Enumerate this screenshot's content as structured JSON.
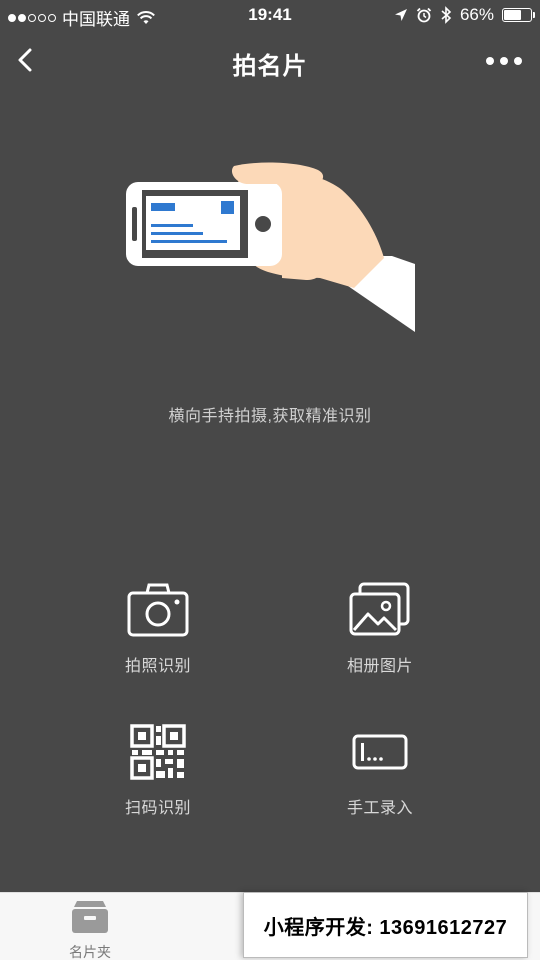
{
  "status_bar": {
    "carrier": "中国联通",
    "time": "19:41",
    "battery": "66%",
    "battery_level": 0.66,
    "signal_bars": 2,
    "icons": [
      "wifi-icon",
      "location-arrow-icon",
      "alarm-icon",
      "bluetooth-icon",
      "battery-icon"
    ]
  },
  "nav": {
    "title": "拍名片",
    "back_icon": "chevron-left-icon",
    "more_icon": "more-dots-icon"
  },
  "hint_text": "横向手持拍摄,获取精准识别",
  "actions": [
    {
      "label": "拍照识别",
      "icon": "camera-icon"
    },
    {
      "label": "相册图片",
      "icon": "photo-album-icon"
    },
    {
      "label": "扫码识别",
      "icon": "qr-code-icon"
    },
    {
      "label": "手工录入",
      "icon": "manual-input-icon"
    }
  ],
  "tab_bar": {
    "tabs": [
      {
        "label": "名片夹",
        "icon": "card-box-icon"
      }
    ]
  },
  "watermark": "小程序开发: 13691612727",
  "colors": {
    "background": "#484848",
    "accent_blue": "#2f79d0",
    "skin": "#fcd9b8",
    "tab_bar": "#f7f7f7"
  }
}
